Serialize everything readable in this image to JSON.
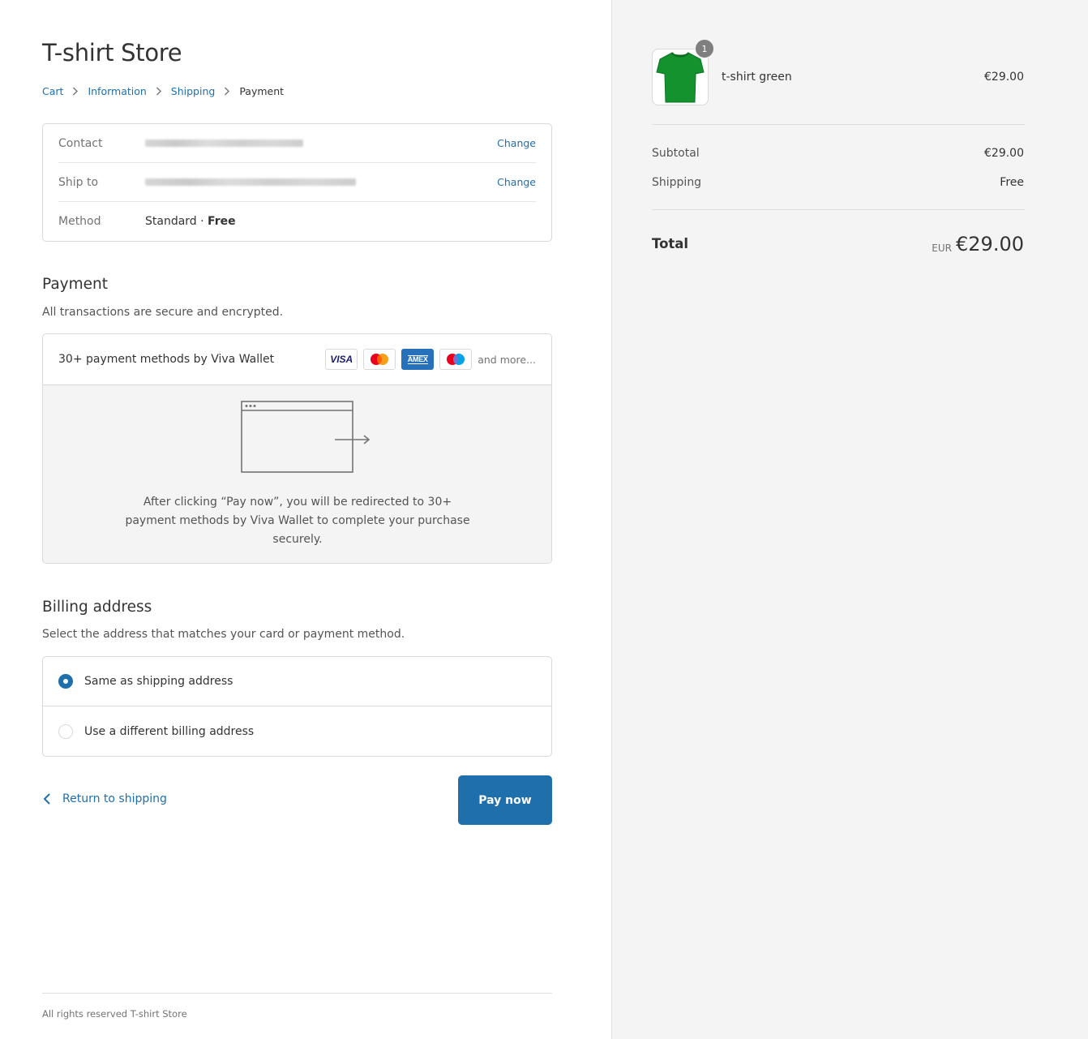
{
  "store": {
    "title": "T-shirt Store"
  },
  "breadcrumb": [
    {
      "label": "Cart"
    },
    {
      "label": "Information"
    },
    {
      "label": "Shipping"
    },
    {
      "label": "Payment"
    }
  ],
  "review": {
    "contact_label": "Contact",
    "ship_label": "Ship to",
    "method_label": "Method",
    "method_value": "Standard · ",
    "method_price": "Free",
    "change_label": "Change"
  },
  "payment": {
    "title": "Payment",
    "subtitle": "All transactions are secure and encrypted.",
    "provider_label": "30+ payment methods by Viva Wallet",
    "cards": [
      "VISA",
      "mastercard-icon",
      "AMEX",
      "maestro-icon"
    ],
    "and_more": "and more...",
    "redirect_text": "After clicking “Pay now”, you will be redirected to 30+ payment methods by Viva Wallet to complete your purchase securely."
  },
  "billing": {
    "title": "Billing address",
    "subtitle": "Select the address that matches your card or payment method.",
    "options": [
      {
        "label": "Same as shipping address",
        "selected": true
      },
      {
        "label": "Use a different billing address",
        "selected": false
      }
    ]
  },
  "actions": {
    "return_label": "Return to shipping",
    "pay_label": "Pay now"
  },
  "footer": {
    "text": "All rights reserved T-shirt Store"
  },
  "summary": {
    "product_name": "t-shirt green",
    "product_price": "€29.00",
    "quantity": "1",
    "subtotal_label": "Subtotal",
    "subtotal_value": "€29.00",
    "shipping_label": "Shipping",
    "shipping_value": "Free",
    "total_label": "Total",
    "total_currency": "EUR",
    "total_value": "€29.00"
  },
  "colors": {
    "accent": "#1f6fad",
    "product": "#13922e"
  }
}
